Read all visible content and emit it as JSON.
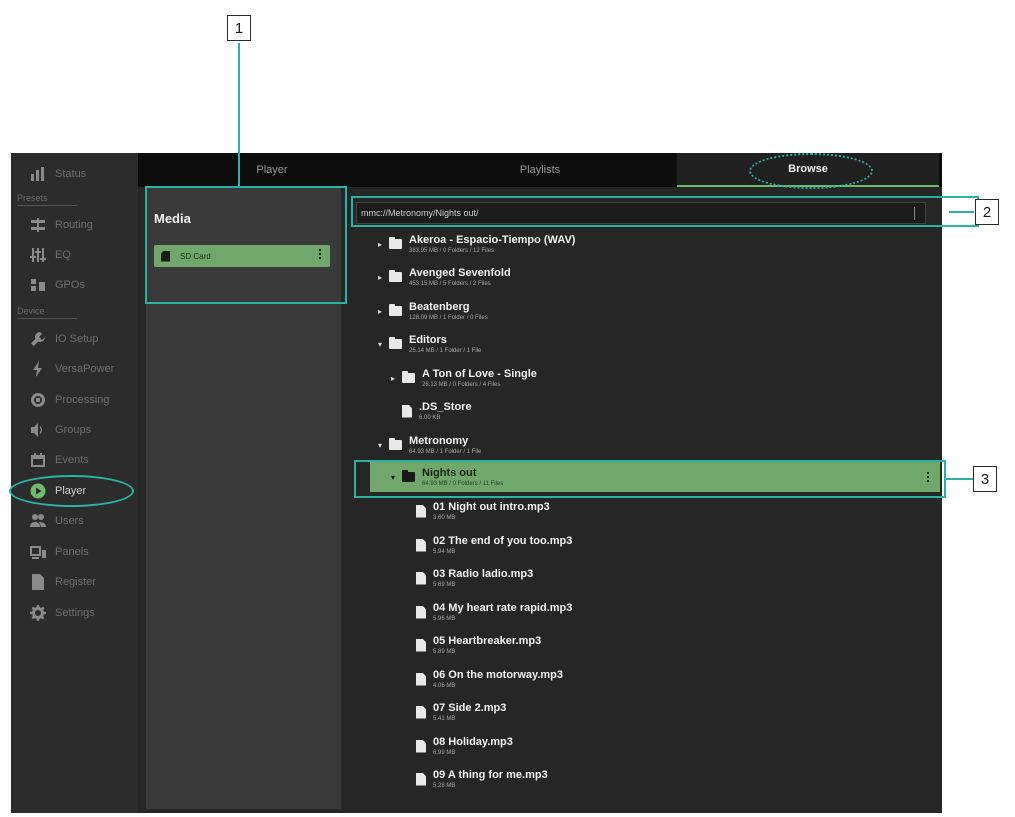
{
  "sidebar": {
    "sections": [
      "Presets",
      "Device"
    ],
    "items": [
      {
        "label": "Status",
        "icon": "bar-chart-icon"
      },
      {
        "label": "Routing",
        "icon": "routing-icon"
      },
      {
        "label": "EQ",
        "icon": "eq-sliders-icon"
      },
      {
        "label": "GPOs",
        "icon": "gpo-icon"
      },
      {
        "label": "IO Setup",
        "icon": "wrench-icon"
      },
      {
        "label": "VersaPower",
        "icon": "lightning-icon"
      },
      {
        "label": "Processing",
        "icon": "chip-icon"
      },
      {
        "label": "Groups",
        "icon": "speaker-icon"
      },
      {
        "label": "Events",
        "icon": "calendar-icon"
      },
      {
        "label": "Player",
        "icon": "play-icon"
      },
      {
        "label": "Users",
        "icon": "users-icon"
      },
      {
        "label": "Panels",
        "icon": "panels-icon"
      },
      {
        "label": "Register",
        "icon": "document-icon"
      },
      {
        "label": "Settings",
        "icon": "gear-icon"
      }
    ]
  },
  "tabs": [
    {
      "label": "Player"
    },
    {
      "label": "Playlists"
    },
    {
      "label": "Browse"
    }
  ],
  "media": {
    "title": "Media",
    "items": [
      {
        "label": "SD Card"
      }
    ]
  },
  "browse": {
    "path": "mmc://Metronomy/Nights out/",
    "rows": [
      {
        "name": "Akeroa - Espacio-Tiempo (WAV)",
        "meta": "383.95 MB / 0 Folders / 12 Files",
        "type": "folder",
        "arrow": "▸"
      },
      {
        "name": "Avenged Sevenfold",
        "meta": "453.15 MB / 5 Folders / 2 Files",
        "type": "folder",
        "arrow": "▸"
      },
      {
        "name": "Beatenberg",
        "meta": "128.09 MB / 1 Folder / 0 Files",
        "type": "folder",
        "arrow": "▸"
      },
      {
        "name": "Editors",
        "meta": "26.14 MB / 1 Folder / 1 File",
        "type": "folder",
        "arrow": "▾"
      },
      {
        "name": "A Ton of Love - Single",
        "meta": "26.13 MB / 0 Folders / 4 Files",
        "type": "folder",
        "arrow": "▸"
      },
      {
        "name": ".DS_Store",
        "meta": "6.00 KB",
        "type": "file",
        "arrow": ""
      },
      {
        "name": "Metronomy",
        "meta": "64.93 MB / 1 Folder / 1 File",
        "type": "folder",
        "arrow": "▾"
      },
      {
        "name": "Nights out",
        "meta": "64.93 MB / 0 Folders / 11 Files",
        "type": "folder",
        "arrow": "▾"
      },
      {
        "name": "01 Night out intro.mp3",
        "meta": "3.60 MB",
        "type": "file",
        "arrow": ""
      },
      {
        "name": "02 The end of you too.mp3",
        "meta": "5.94 MB",
        "type": "file",
        "arrow": ""
      },
      {
        "name": "03 Radio ladio.mp3",
        "meta": "5.69 MB",
        "type": "file",
        "arrow": ""
      },
      {
        "name": "04 My heart rate rapid.mp3",
        "meta": "5.96 MB",
        "type": "file",
        "arrow": ""
      },
      {
        "name": "05 Heartbreaker.mp3",
        "meta": "5.89 MB",
        "type": "file",
        "arrow": ""
      },
      {
        "name": "06 On the motorway.mp3",
        "meta": "4.06 MB",
        "type": "file",
        "arrow": ""
      },
      {
        "name": "07 Side 2.mp3",
        "meta": "5.41 MB",
        "type": "file",
        "arrow": ""
      },
      {
        "name": "08 Holiday.mp3",
        "meta": "6.99 MB",
        "type": "file",
        "arrow": ""
      },
      {
        "name": "09 A thing for me.mp3",
        "meta": "5.28 MB",
        "type": "file",
        "arrow": ""
      }
    ]
  },
  "annotations": [
    {
      "number": "1"
    },
    {
      "number": "2"
    },
    {
      "number": "3"
    }
  ],
  "colors": {
    "accent": "#6fa86a",
    "annotation": "#2ab3a5",
    "background": "#262626"
  }
}
